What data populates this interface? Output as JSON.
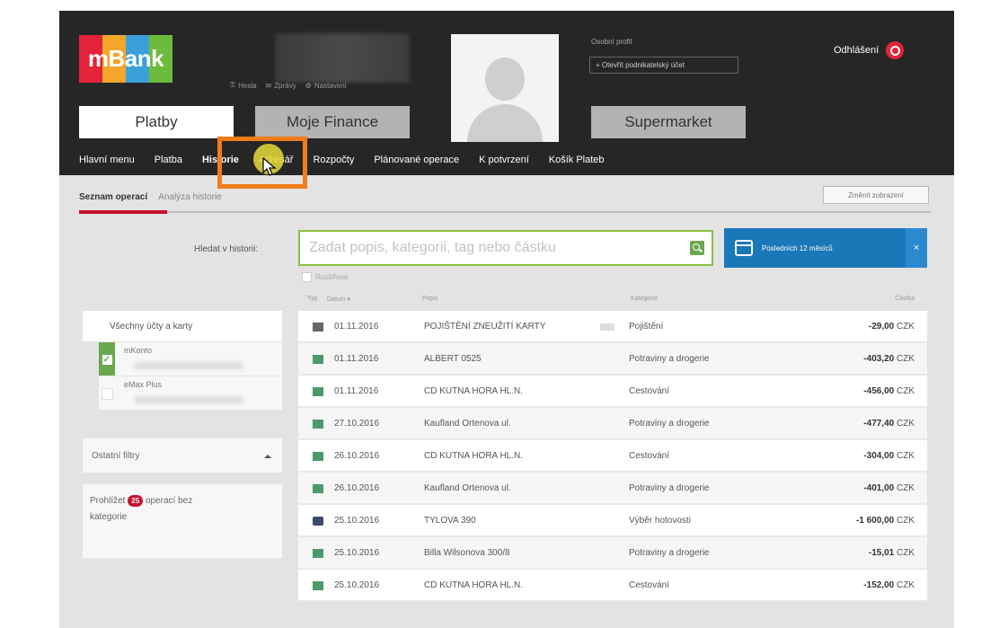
{
  "header": {
    "logo_text": "mBank",
    "logo_colors": [
      "#e2233a",
      "#f4a62a",
      "#3aa1d8",
      "#6cbb3c"
    ],
    "user_links": [
      "Hesla",
      "Zprávy",
      "Nastavení"
    ],
    "profile_label": "Osobní profil",
    "profile_button": "+ Otevřít podnikatelský účet",
    "logout_label": "Odhlášení"
  },
  "main_tabs": [
    {
      "label": "Platby",
      "active": true
    },
    {
      "label": "Moje Finance",
      "active": false
    },
    {
      "label": "Supermarket",
      "active": false
    }
  ],
  "subnav": [
    {
      "label": "Hlavní menu"
    },
    {
      "label": "Platba"
    },
    {
      "label": "Historie"
    },
    {
      "label": "Adresář"
    },
    {
      "label": "Rozpočty"
    },
    {
      "label": "Plánované operace"
    },
    {
      "label": "K potvrzení"
    },
    {
      "label": "Košík Plateb"
    }
  ],
  "history": {
    "tab_list": "Seznam operací",
    "tab_analysis": "Analýza historie",
    "view_button": "Změnit zobrazení",
    "search_label": "Hledat v historii:",
    "search_placeholder": "Zadat popis, kategorii, tag nebo částku",
    "extended_label": "Rozšířené",
    "period_label": "Posledních 12 měsíců",
    "period_close": "×"
  },
  "filters": {
    "all_accounts": "Všechny účty a karty",
    "accounts": [
      {
        "name": "mKonto",
        "checked": true
      },
      {
        "name": "eMax Plus",
        "checked": false
      }
    ],
    "other_filters": "Ostatní filtry",
    "uncat_prefix": "Prohlížet",
    "uncat_count": "25",
    "uncat_suffix": "operací bez",
    "uncat_line2": "kategorie"
  },
  "table": {
    "headers": {
      "type": "Typ",
      "date": "Datum ▾",
      "payee": "Popis",
      "category": "Kategorie",
      "amount": "Částka"
    },
    "rows": [
      {
        "icon": "gray",
        "date": "01.11.2016",
        "payee": "POJIŠTĚNÍ ZNEUŽITÍ KARTY",
        "note": true,
        "category": "Pojištění",
        "amount": "-29,00",
        "currency": "CZK"
      },
      {
        "icon": "green",
        "date": "01.11.2016",
        "payee": "ALBERT 0525",
        "note": false,
        "category": "Potraviny a drogerie",
        "amount": "-403,20",
        "currency": "CZK"
      },
      {
        "icon": "green",
        "date": "01.11.2016",
        "payee": "CD KUTNA HORA HL.N.",
        "note": false,
        "category": "Cestování",
        "amount": "-456,00",
        "currency": "CZK"
      },
      {
        "icon": "doc",
        "date": "27.10.2016",
        "payee": "Kaufland Ortenova ul.",
        "note": false,
        "category": "Potraviny a drogerie",
        "amount": "-477,40",
        "currency": "CZK"
      },
      {
        "icon": "doc",
        "date": "26.10.2016",
        "payee": "CD KUTNA HORA HL.N.",
        "note": false,
        "category": "Cestování",
        "amount": "-304,00",
        "currency": "CZK"
      },
      {
        "icon": "doc",
        "date": "26.10.2016",
        "payee": "Kaufland Ortenova ul.",
        "note": false,
        "category": "Potraviny a drogerie",
        "amount": "-401,00",
        "currency": "CZK"
      },
      {
        "icon": "blue",
        "date": "25.10.2016",
        "payee": "TYLOVA 390",
        "note": false,
        "category": "Výběr hotovosti",
        "amount": "-1 600,00",
        "currency": "CZK"
      },
      {
        "icon": "doc",
        "date": "25.10.2016",
        "payee": "Billa Wilsonova 300/8",
        "note": false,
        "category": "Potraviny a drogerie",
        "amount": "-15,01",
        "currency": "CZK"
      },
      {
        "icon": "doc",
        "date": "25.10.2016",
        "payee": "CD KUTNA HORA HL.N.",
        "note": false,
        "category": "Cestování",
        "amount": "-152,00",
        "currency": "CZK"
      }
    ]
  }
}
